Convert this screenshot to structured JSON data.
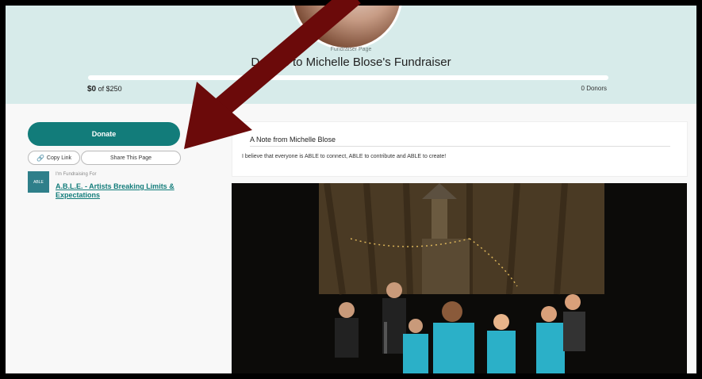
{
  "header": {
    "kicker": "Fundraiser Page",
    "title": "Donate to Michelle Blose's Fundraiser"
  },
  "progress": {
    "raised": "$0",
    "goal_text": "of $250",
    "donors": "0 Donors",
    "fraction": 0
  },
  "actions": {
    "donate_label": "Donate",
    "copy_label": "Copy Link",
    "share_label": "Share This Page"
  },
  "cause": {
    "kicker": "I'm Fundraising For",
    "name": "A.B.L.E. - Artists Breaking Limits & Expectations",
    "logo_text": "ABLE"
  },
  "note": {
    "title": "A Note from Michelle Blose",
    "body": "I believe that everyone is ABLE to connect, ABLE to contribute and ABLE to create!"
  },
  "colors": {
    "accent": "#127c7a",
    "hero_bg": "#d7ebea",
    "arrow": "#6b0a0a"
  },
  "icons": {
    "link": "link-icon",
    "arrow": "annotation-arrow"
  }
}
